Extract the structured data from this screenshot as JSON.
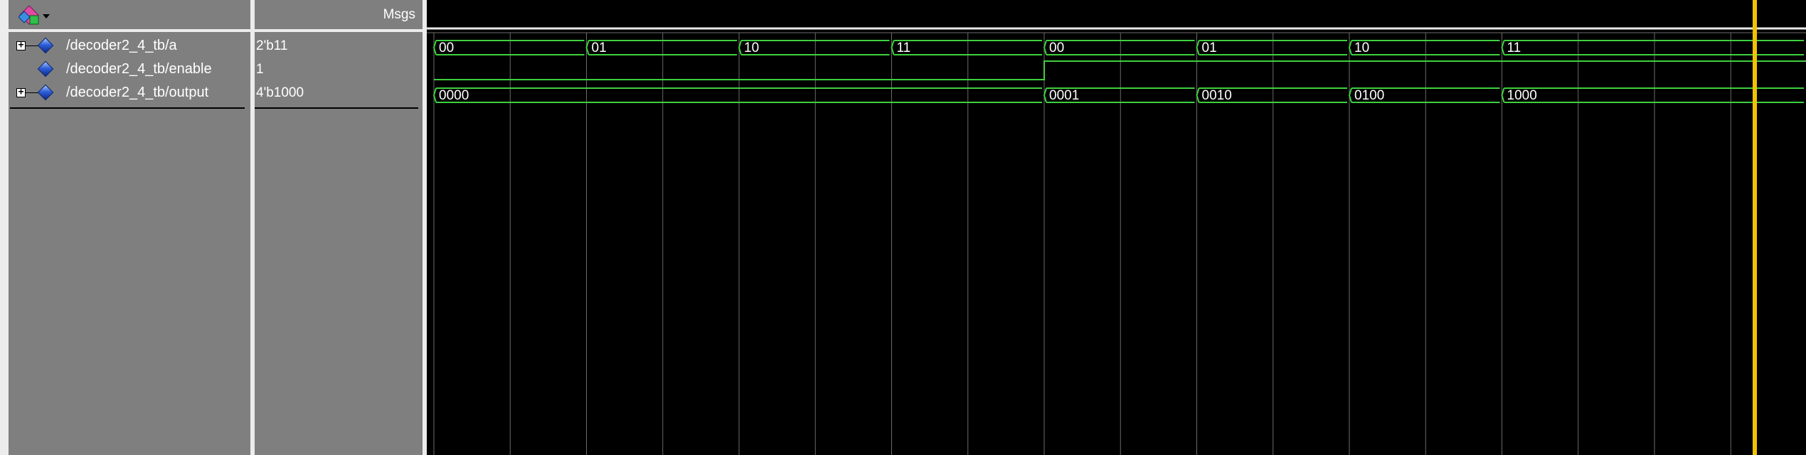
{
  "header": {
    "msgs_label": "Msgs"
  },
  "toolbar": {
    "icon": "wave-tool-icon"
  },
  "signals": [
    {
      "name": "/decoder2_4_tb/a",
      "value": "2'b11",
      "expandable": true
    },
    {
      "name": "/decoder2_4_tb/enable",
      "value": "1",
      "expandable": false
    },
    {
      "name": "/decoder2_4_tb/output",
      "value": "4'b1000",
      "expandable": true
    }
  ],
  "waves": {
    "a": [
      "00",
      "01",
      "10",
      "11",
      "00",
      "01",
      "10",
      "11"
    ],
    "enable_low_then_high": [
      "0",
      "1"
    ],
    "output": [
      "0000",
      "0001",
      "0010",
      "0100",
      "1000"
    ]
  },
  "colors": {
    "wave": "#3fd03f",
    "grid": "#6b6b6b",
    "cursor": "#f2c200",
    "bus_text": "#ffffff"
  }
}
